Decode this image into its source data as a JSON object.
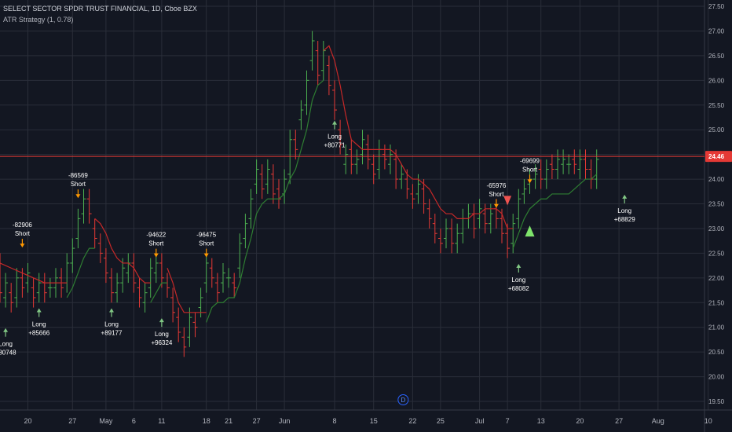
{
  "header": {
    "title": "SELECT SECTOR SPDR TRUST FINANCIAL, 1D, Cboe BZX",
    "indicator": "ATR Strategy (1, 0.78)"
  },
  "colors": {
    "background": "#131722",
    "grid": "#2a2e39",
    "up_bar": "#4caf50",
    "down_bar": "#e53935",
    "line_long": "#2e7d32",
    "line_short": "#c62828",
    "arrow_long": "#81c784",
    "arrow_short": "#ff9800",
    "price_line": "#e53935"
  },
  "chart_data": {
    "type": "line",
    "ylim": [
      19.5,
      27.5
    ],
    "yticks": [
      "27.50",
      "27.00",
      "26.50",
      "26.00",
      "25.50",
      "25.00",
      "24.50",
      "24.00",
      "23.50",
      "23.00",
      "22.50",
      "22.00",
      "21.50",
      "21.00",
      "20.50",
      "20.00",
      "19.50"
    ],
    "xlim": [
      0,
      134
    ],
    "xticks": [
      {
        "label": "20",
        "x": 5
      },
      {
        "label": "27",
        "x": 13
      },
      {
        "label": "May",
        "x": 19
      },
      {
        "label": "6",
        "x": 24
      },
      {
        "label": "11",
        "x": 29
      },
      {
        "label": "18",
        "x": 37
      },
      {
        "label": "21",
        "x": 41
      },
      {
        "label": "27",
        "x": 46
      },
      {
        "label": "Jun",
        "x": 51
      },
      {
        "label": "8",
        "x": 60
      },
      {
        "label": "15",
        "x": 67
      },
      {
        "label": "22",
        "x": 74
      },
      {
        "label": "25",
        "x": 79
      },
      {
        "label": "Jul",
        "x": 86
      },
      {
        "label": "7",
        "x": 91
      },
      {
        "label": "13",
        "x": 97
      },
      {
        "label": "20",
        "x": 104
      },
      {
        "label": "27",
        "x": 111
      },
      {
        "label": "Aug",
        "x": 118
      },
      {
        "label": "10",
        "x": 127
      }
    ],
    "last_price": "24.46",
    "bars": [
      {
        "x": 0,
        "o": 22.3,
        "c": 21.7
      },
      {
        "x": 1,
        "o": 21.6,
        "c": 21.9
      },
      {
        "x": 2,
        "o": 21.7,
        "c": 21.5
      },
      {
        "x": 3,
        "o": 21.6,
        "c": 22.0
      },
      {
        "x": 4,
        "o": 22.0,
        "c": 21.8
      },
      {
        "x": 5,
        "o": 21.9,
        "c": 22.1
      },
      {
        "x": 6,
        "o": 21.8,
        "c": 21.6
      },
      {
        "x": 7,
        "o": 21.7,
        "c": 21.9
      },
      {
        "x": 8,
        "o": 21.9,
        "c": 21.7
      },
      {
        "x": 9,
        "o": 21.8,
        "c": 21.8
      },
      {
        "x": 10,
        "o": 21.8,
        "c": 22.0
      },
      {
        "x": 11,
        "o": 22.0,
        "c": 21.8
      },
      {
        "x": 12,
        "o": 21.9,
        "c": 22.3
      },
      {
        "x": 13,
        "o": 22.3,
        "c": 22.6
      },
      {
        "x": 14,
        "o": 22.8,
        "c": 23.2
      },
      {
        "x": 15,
        "o": 23.3,
        "c": 23.6
      },
      {
        "x": 16,
        "o": 23.6,
        "c": 23.3
      },
      {
        "x": 17,
        "o": 23.0,
        "c": 22.8
      },
      {
        "x": 18,
        "o": 22.7,
        "c": 22.5
      },
      {
        "x": 19,
        "o": 22.4,
        "c": 22.1
      },
      {
        "x": 20,
        "o": 22.0,
        "c": 21.7
      },
      {
        "x": 21,
        "o": 21.7,
        "c": 21.9
      },
      {
        "x": 22,
        "o": 21.9,
        "c": 22.2
      },
      {
        "x": 23,
        "o": 22.1,
        "c": 22.3
      },
      {
        "x": 24,
        "o": 22.3,
        "c": 21.9
      },
      {
        "x": 25,
        "o": 21.8,
        "c": 21.6
      },
      {
        "x": 26,
        "o": 21.5,
        "c": 21.7
      },
      {
        "x": 27,
        "o": 21.8,
        "c": 22.2
      },
      {
        "x": 28,
        "o": 22.1,
        "c": 22.3
      },
      {
        "x": 29,
        "o": 22.3,
        "c": 22.0
      },
      {
        "x": 30,
        "o": 21.9,
        "c": 21.8
      },
      {
        "x": 31,
        "o": 21.6,
        "c": 21.3
      },
      {
        "x": 32,
        "o": 21.2,
        "c": 20.9
      },
      {
        "x": 33,
        "o": 20.8,
        "c": 20.6
      },
      {
        "x": 34,
        "o": 20.8,
        "c": 21.2
      },
      {
        "x": 35,
        "o": 21.1,
        "c": 21.0
      },
      {
        "x": 36,
        "o": 21.4,
        "c": 21.6
      },
      {
        "x": 37,
        "o": 21.9,
        "c": 22.3
      },
      {
        "x": 38,
        "o": 22.2,
        "c": 22.0
      },
      {
        "x": 39,
        "o": 21.9,
        "c": 21.7
      },
      {
        "x": 40,
        "o": 21.9,
        "c": 22.1
      },
      {
        "x": 41,
        "o": 22.0,
        "c": 22.0
      },
      {
        "x": 42,
        "o": 21.9,
        "c": 21.8
      },
      {
        "x": 43,
        "o": 22.2,
        "c": 22.7
      },
      {
        "x": 44,
        "o": 22.8,
        "c": 23.1
      },
      {
        "x": 45,
        "o": 23.2,
        "c": 23.6
      },
      {
        "x": 46,
        "o": 23.9,
        "c": 24.2
      },
      {
        "x": 47,
        "o": 24.1,
        "c": 23.8
      },
      {
        "x": 48,
        "o": 23.9,
        "c": 24.2
      },
      {
        "x": 49,
        "o": 24.1,
        "c": 23.7
      },
      {
        "x": 50,
        "o": 23.8,
        "c": 23.6
      },
      {
        "x": 51,
        "o": 23.7,
        "c": 24.0
      },
      {
        "x": 52,
        "o": 24.1,
        "c": 24.8
      },
      {
        "x": 53,
        "o": 24.8,
        "c": 24.6
      },
      {
        "x": 54,
        "o": 25.2,
        "c": 25.4
      },
      {
        "x": 55,
        "o": 25.5,
        "c": 26.0
      },
      {
        "x": 56,
        "o": 26.4,
        "c": 26.8
      },
      {
        "x": 57,
        "o": 26.6,
        "c": 26.1
      },
      {
        "x": 58,
        "o": 26.2,
        "c": 26.6
      },
      {
        "x": 59,
        "o": 26.3,
        "c": 25.9
      },
      {
        "x": 60,
        "o": 25.8,
        "c": 25.4
      },
      {
        "x": 61,
        "o": 25.0,
        "c": 24.7
      },
      {
        "x": 62,
        "o": 24.3,
        "c": 24.5
      },
      {
        "x": 63,
        "o": 24.6,
        "c": 24.3
      },
      {
        "x": 64,
        "o": 24.3,
        "c": 24.4
      },
      {
        "x": 65,
        "o": 24.5,
        "c": 24.8
      },
      {
        "x": 66,
        "o": 24.7,
        "c": 24.4
      },
      {
        "x": 67,
        "o": 24.3,
        "c": 24.1
      },
      {
        "x": 68,
        "o": 24.2,
        "c": 24.6
      },
      {
        "x": 69,
        "o": 24.5,
        "c": 24.4
      },
      {
        "x": 70,
        "o": 24.3,
        "c": 24.5
      },
      {
        "x": 71,
        "o": 24.4,
        "c": 24.0
      },
      {
        "x": 72,
        "o": 24.0,
        "c": 24.1
      },
      {
        "x": 73,
        "o": 24.0,
        "c": 23.8
      },
      {
        "x": 74,
        "o": 23.7,
        "c": 23.6
      },
      {
        "x": 75,
        "o": 23.7,
        "c": 23.9
      },
      {
        "x": 76,
        "o": 23.8,
        "c": 23.5
      },
      {
        "x": 77,
        "o": 23.4,
        "c": 23.2
      },
      {
        "x": 78,
        "o": 23.1,
        "c": 22.9
      },
      {
        "x": 79,
        "o": 22.8,
        "c": 22.7
      },
      {
        "x": 80,
        "o": 22.8,
        "c": 23.0
      },
      {
        "x": 81,
        "o": 23.0,
        "c": 22.7
      },
      {
        "x": 82,
        "o": 22.7,
        "c": 22.9
      },
      {
        "x": 83,
        "o": 22.9,
        "c": 23.2
      },
      {
        "x": 84,
        "o": 23.2,
        "c": 23.3
      },
      {
        "x": 85,
        "o": 23.3,
        "c": 23.0
      },
      {
        "x": 86,
        "o": 23.2,
        "c": 23.4
      },
      {
        "x": 87,
        "o": 23.3,
        "c": 23.1
      },
      {
        "x": 88,
        "o": 23.1,
        "c": 23.3
      },
      {
        "x": 89,
        "o": 23.4,
        "c": 23.2
      },
      {
        "x": 90,
        "o": 23.2,
        "c": 22.9
      },
      {
        "x": 91,
        "o": 22.9,
        "c": 22.6
      },
      {
        "x": 92,
        "o": 22.7,
        "c": 23.1
      },
      {
        "x": 93,
        "o": 23.2,
        "c": 23.6
      },
      {
        "x": 94,
        "o": 23.7,
        "c": 23.8
      },
      {
        "x": 95,
        "o": 23.9,
        "c": 24.0
      },
      {
        "x": 96,
        "o": 24.0,
        "c": 24.1
      },
      {
        "x": 97,
        "o": 24.2,
        "c": 24.0
      },
      {
        "x": 98,
        "o": 24.0,
        "c": 24.2
      },
      {
        "x": 99,
        "o": 24.3,
        "c": 24.2
      },
      {
        "x": 100,
        "o": 24.2,
        "c": 24.4
      },
      {
        "x": 101,
        "o": 24.3,
        "c": 24.4
      },
      {
        "x": 102,
        "o": 24.3,
        "c": 24.3
      },
      {
        "x": 103,
        "o": 24.4,
        "c": 24.3
      },
      {
        "x": 104,
        "o": 24.2,
        "c": 24.4
      },
      {
        "x": 105,
        "o": 24.4,
        "c": 24.2
      },
      {
        "x": 106,
        "o": 24.2,
        "c": 24.0
      },
      {
        "x": 107,
        "o": 24.0,
        "c": 24.4
      }
    ],
    "series": [
      {
        "kind": "short",
        "points": [
          [
            0,
            22.3
          ],
          [
            2,
            22.2
          ],
          [
            4,
            22.1
          ],
          [
            6,
            22.0
          ],
          [
            8,
            21.9
          ],
          [
            10,
            21.9
          ],
          [
            12,
            21.9
          ]
        ]
      },
      {
        "kind": "long",
        "points": [
          [
            12,
            21.6
          ],
          [
            13,
            21.8
          ],
          [
            14,
            22.1
          ],
          [
            15,
            22.4
          ],
          [
            16,
            22.6
          ],
          [
            17,
            22.6
          ]
        ]
      },
      {
        "kind": "short",
        "points": [
          [
            17,
            23.2
          ],
          [
            18,
            23.1
          ],
          [
            19,
            22.9
          ],
          [
            20,
            22.6
          ],
          [
            21,
            22.4
          ],
          [
            22,
            22.3
          ],
          [
            23,
            22.3
          ],
          [
            24,
            22.2
          ],
          [
            25,
            22.0
          ],
          [
            26,
            21.9
          ],
          [
            27,
            21.9
          ]
        ]
      },
      {
        "kind": "long",
        "points": [
          [
            27,
            21.5
          ],
          [
            28,
            21.7
          ],
          [
            29,
            21.9
          ],
          [
            30,
            21.9
          ]
        ]
      },
      {
        "kind": "short",
        "points": [
          [
            30,
            22.2
          ],
          [
            31,
            21.9
          ],
          [
            32,
            21.5
          ],
          [
            33,
            21.3
          ],
          [
            34,
            21.3
          ],
          [
            35,
            21.3
          ],
          [
            36,
            21.3
          ],
          [
            37,
            21.3
          ]
        ]
      },
      {
        "kind": "long",
        "points": [
          [
            37,
            21.1
          ],
          [
            38,
            21.4
          ],
          [
            39,
            21.5
          ],
          [
            40,
            21.5
          ],
          [
            41,
            21.6
          ],
          [
            42,
            21.6
          ],
          [
            43,
            21.9
          ],
          [
            44,
            22.4
          ],
          [
            45,
            22.8
          ],
          [
            46,
            23.3
          ],
          [
            47,
            23.5
          ],
          [
            48,
            23.6
          ],
          [
            49,
            23.6
          ],
          [
            50,
            23.6
          ],
          [
            51,
            23.7
          ],
          [
            52,
            24.0
          ],
          [
            53,
            24.2
          ],
          [
            54,
            24.6
          ],
          [
            55,
            25.0
          ],
          [
            56,
            25.6
          ],
          [
            57,
            25.9
          ],
          [
            58,
            26.0
          ]
        ]
      },
      {
        "kind": "short",
        "points": [
          [
            58,
            26.6
          ],
          [
            59,
            26.7
          ],
          [
            60,
            26.4
          ],
          [
            61,
            25.9
          ],
          [
            62,
            25.3
          ],
          [
            63,
            24.8
          ],
          [
            64,
            24.7
          ],
          [
            65,
            24.6
          ],
          [
            66,
            24.6
          ],
          [
            67,
            24.6
          ],
          [
            68,
            24.6
          ],
          [
            69,
            24.6
          ],
          [
            70,
            24.6
          ],
          [
            71,
            24.5
          ],
          [
            72,
            24.3
          ],
          [
            73,
            24.1
          ],
          [
            74,
            24.0
          ],
          [
            75,
            24.0
          ],
          [
            76,
            23.9
          ],
          [
            77,
            23.8
          ],
          [
            78,
            23.6
          ],
          [
            79,
            23.4
          ],
          [
            80,
            23.3
          ],
          [
            81,
            23.3
          ],
          [
            82,
            23.2
          ],
          [
            83,
            23.2
          ],
          [
            84,
            23.2
          ],
          [
            85,
            23.3
          ],
          [
            86,
            23.3
          ],
          [
            87,
            23.4
          ],
          [
            88,
            23.4
          ],
          [
            89,
            23.4
          ],
          [
            90,
            23.3
          ],
          [
            91,
            23.0
          ],
          [
            92,
            23.0
          ]
        ]
      },
      {
        "kind": "long",
        "points": [
          [
            92,
            22.6
          ],
          [
            93,
            22.9
          ],
          [
            94,
            23.2
          ],
          [
            95,
            23.4
          ],
          [
            96,
            23.5
          ],
          [
            97,
            23.6
          ],
          [
            98,
            23.6
          ],
          [
            99,
            23.7
          ],
          [
            100,
            23.7
          ],
          [
            101,
            23.7
          ],
          [
            102,
            23.7
          ],
          [
            103,
            23.8
          ],
          [
            104,
            23.9
          ],
          [
            105,
            24.0
          ],
          [
            106,
            24.0
          ],
          [
            107,
            24.1
          ]
        ]
      }
    ],
    "annotations": [
      {
        "x": 1,
        "price": 21.0,
        "dir": "long",
        "lines": [
          "Long",
          "+80748"
        ]
      },
      {
        "x": 4,
        "price": 22.6,
        "dir": "short",
        "lines": [
          "-82906",
          "Short"
        ]
      },
      {
        "x": 7,
        "price": 21.4,
        "dir": "long",
        "lines": [
          "Long",
          "+85666"
        ]
      },
      {
        "x": 14,
        "price": 23.6,
        "dir": "short",
        "lines": [
          "-86569",
          "Short"
        ]
      },
      {
        "x": 20,
        "price": 21.4,
        "dir": "long",
        "lines": [
          "Long",
          "+89177"
        ]
      },
      {
        "x": 28,
        "price": 22.4,
        "dir": "short",
        "lines": [
          "-94622",
          "Short"
        ]
      },
      {
        "x": 29,
        "price": 21.2,
        "dir": "long",
        "lines": [
          "Long",
          "+96324"
        ]
      },
      {
        "x": 37,
        "price": 22.4,
        "dir": "short",
        "lines": [
          "-96475",
          "Short"
        ]
      },
      {
        "x": 60,
        "price": 25.2,
        "dir": "long",
        "lines": [
          "Long",
          "+80771"
        ]
      },
      {
        "x": 89,
        "price": 23.4,
        "dir": "short",
        "lines": [
          "-65976",
          "Short"
        ]
      },
      {
        "x": 93,
        "price": 22.3,
        "dir": "long",
        "lines": [
          "Long",
          "+68082"
        ]
      },
      {
        "x": 95,
        "price": 23.9,
        "dir": "short",
        "lines": [
          "-69699",
          "Short"
        ]
      },
      {
        "x": 112,
        "price": 23.7,
        "dir": "long",
        "lines": [
          "Long",
          "+68829"
        ]
      }
    ],
    "signals": [
      {
        "x": 91,
        "price": 23.55,
        "dir": "down"
      },
      {
        "x": 95,
        "price": 22.95,
        "dir": "up"
      }
    ],
    "marker": "D"
  }
}
